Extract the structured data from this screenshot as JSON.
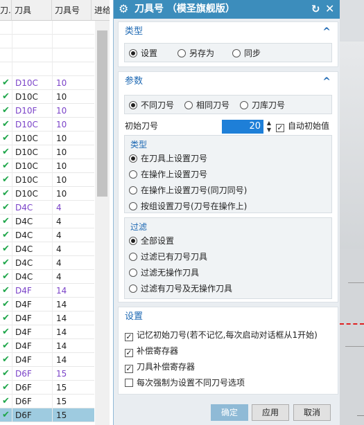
{
  "table": {
    "headers": [
      "刀.",
      "刀具",
      "刀具号",
      "进给"
    ],
    "blank_rows": 4,
    "rows": [
      {
        "tool": "D10C",
        "num": "10",
        "purple": true
      },
      {
        "tool": "D10C",
        "num": "10",
        "purple": false
      },
      {
        "tool": "D10F",
        "num": "10",
        "purple": true
      },
      {
        "tool": "D10C",
        "num": "10",
        "purple": true
      },
      {
        "tool": "D10C",
        "num": "10",
        "purple": false
      },
      {
        "tool": "D10C",
        "num": "10",
        "purple": false
      },
      {
        "tool": "D10C",
        "num": "10",
        "purple": false
      },
      {
        "tool": "D10C",
        "num": "10",
        "purple": false
      },
      {
        "tool": "D10C",
        "num": "10",
        "purple": false
      },
      {
        "tool": "D4C",
        "num": "4",
        "purple": true
      },
      {
        "tool": "D4C",
        "num": "4",
        "purple": false
      },
      {
        "tool": "D4C",
        "num": "4",
        "purple": false
      },
      {
        "tool": "D4C",
        "num": "4",
        "purple": false
      },
      {
        "tool": "D4C",
        "num": "4",
        "purple": false
      },
      {
        "tool": "D4C",
        "num": "4",
        "purple": false
      },
      {
        "tool": "D4F",
        "num": "14",
        "purple": true
      },
      {
        "tool": "D4F",
        "num": "14",
        "purple": false
      },
      {
        "tool": "D4F",
        "num": "14",
        "purple": false
      },
      {
        "tool": "D4F",
        "num": "14",
        "purple": false
      },
      {
        "tool": "D4F",
        "num": "14",
        "purple": false
      },
      {
        "tool": "D4F",
        "num": "14",
        "purple": false
      },
      {
        "tool": "D6F",
        "num": "15",
        "purple": true
      },
      {
        "tool": "D6F",
        "num": "15",
        "purple": false
      },
      {
        "tool": "D6F",
        "num": "15",
        "purple": false
      },
      {
        "tool": "D6F",
        "num": "15",
        "purple": false,
        "selected": true
      }
    ],
    "check_glyph": "✔"
  },
  "dialog": {
    "title": "刀具号 （模圣旗舰版）",
    "icons": {
      "gear": "gear-icon",
      "reset": "reset-icon",
      "close": "close-icon"
    },
    "type_section": {
      "label": "类型",
      "options": [
        "设置",
        "另存为",
        "同步"
      ],
      "selected": 0
    },
    "params_section": {
      "label": "参数",
      "mode_options": [
        "不同刀号",
        "相同刀号",
        "刀库刀号"
      ],
      "mode_selected": 0,
      "start_label": "初始刀号",
      "start_value": "20",
      "auto_start_label": "自动初始值",
      "auto_start_checked": true,
      "type_group": {
        "title": "类型",
        "options": [
          "在刀具上设置刀号",
          "在操作上设置刀号",
          "在操作上设置刀号(同刀同号)",
          "按组设置刀号(刀号在操作上)"
        ],
        "selected": 0
      },
      "filter_group": {
        "title": "过滤",
        "options": [
          "全部设置",
          "过滤已有刀号刀具",
          "过滤无操作刀具",
          "过滤有刀号及无操作刀具"
        ],
        "selected": 0
      }
    },
    "settings_section": {
      "label": "设置",
      "checks": [
        {
          "label": "记忆初始刀号(若不记忆,每次启动对话框从1开始)",
          "checked": true
        },
        {
          "label": "补偿寄存器",
          "checked": true
        },
        {
          "label": "刀具补偿寄存器",
          "checked": true
        },
        {
          "label": "每次强制为设置不同刀号选项",
          "checked": false
        }
      ]
    },
    "buttons": {
      "ok": "确定",
      "apply": "应用",
      "cancel": "取消"
    },
    "colors": {
      "title_bar": "#3c8dbc",
      "section_label": "#1d68b3",
      "purple_row": "#7a42c8",
      "check_green": "#1fa64a"
    }
  }
}
